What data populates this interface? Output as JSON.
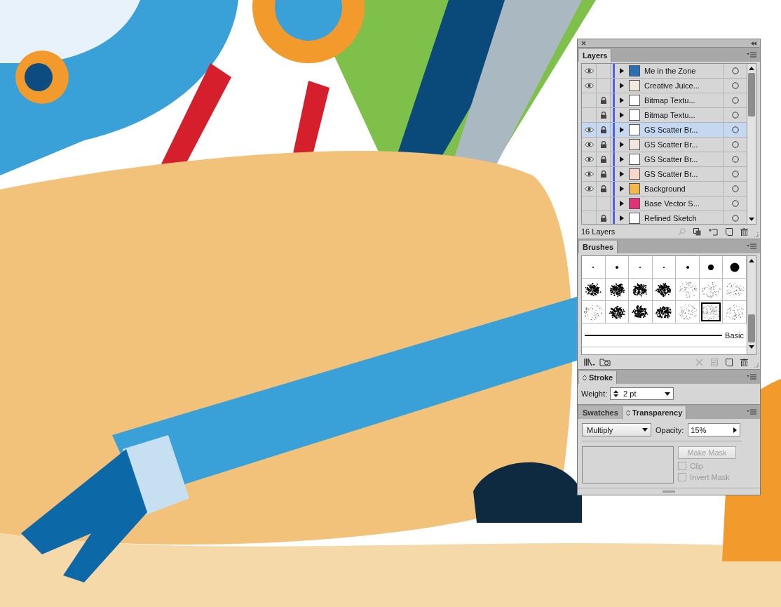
{
  "layers_panel": {
    "tab": "Layers",
    "layers": [
      {
        "name": "Me in the Zone",
        "visible": true,
        "locked": false,
        "selected": false,
        "color": "#2a6fb0"
      },
      {
        "name": "Creative Juice...",
        "visible": true,
        "locked": false,
        "selected": false,
        "color": "#f3e9dc"
      },
      {
        "name": "Bitmap Textu...",
        "visible": false,
        "locked": true,
        "selected": false,
        "color": "#ffffff"
      },
      {
        "name": "Bitmap Textu...",
        "visible": false,
        "locked": true,
        "selected": false,
        "color": "#ffffff"
      },
      {
        "name": "GS Scatter Br...",
        "visible": true,
        "locked": true,
        "selected": true,
        "color": "#ffffff"
      },
      {
        "name": "GS Scatter Br...",
        "visible": true,
        "locked": true,
        "selected": false,
        "color": "#f3e6dc"
      },
      {
        "name": "GS Scatter Br...",
        "visible": true,
        "locked": true,
        "selected": false,
        "color": "#ffffff"
      },
      {
        "name": "GS Scatter Br...",
        "visible": true,
        "locked": true,
        "selected": false,
        "color": "#f6d8c8"
      },
      {
        "name": "Background",
        "visible": true,
        "locked": true,
        "selected": false,
        "color": "#f1b94c"
      },
      {
        "name": "Base Vector S...",
        "visible": false,
        "locked": false,
        "selected": false,
        "color": "#e2337a"
      },
      {
        "name": "Refined Sketch",
        "visible": false,
        "locked": true,
        "selected": false,
        "color": "#ffffff"
      }
    ],
    "count": "16 Layers"
  },
  "brushes_panel": {
    "tab": "Brushes",
    "brushes": [
      {
        "kind": "tiny",
        "selected": false
      },
      {
        "kind": "small",
        "selected": false
      },
      {
        "kind": "tiny",
        "selected": false
      },
      {
        "kind": "tiny",
        "selected": false
      },
      {
        "kind": "small",
        "selected": false
      },
      {
        "kind": "medium",
        "selected": false
      },
      {
        "kind": "large",
        "selected": false
      },
      {
        "kind": "dense",
        "selected": false
      },
      {
        "kind": "dense",
        "selected": false
      },
      {
        "kind": "dense",
        "selected": false
      },
      {
        "kind": "dense",
        "selected": false
      },
      {
        "kind": "light",
        "selected": false
      },
      {
        "kind": "light",
        "selected": false
      },
      {
        "kind": "light",
        "selected": false
      },
      {
        "kind": "light",
        "selected": false
      },
      {
        "kind": "dense",
        "selected": false
      },
      {
        "kind": "dense",
        "selected": false
      },
      {
        "kind": "dense",
        "selected": false
      },
      {
        "kind": "light",
        "selected": false
      },
      {
        "kind": "light",
        "selected": true
      },
      {
        "kind": "light",
        "selected": false
      }
    ],
    "stroke_brush": "Basic"
  },
  "stroke_panel": {
    "tab": "Stroke",
    "weight_label": "Weight:",
    "weight": "2 pt"
  },
  "transparency_panel": {
    "tabs": [
      {
        "label": "Swatches",
        "selected": false
      },
      {
        "label": "Transparency",
        "selected": true
      }
    ],
    "blend_mode": "Multiply",
    "opacity_label": "Opacity:",
    "opacity": "15%",
    "make_mask": {
      "label": "Make Mask",
      "disabled": true
    },
    "options": [
      {
        "label": "Clip",
        "checked": false,
        "disabled": true
      },
      {
        "label": "Invert Mask",
        "checked": false,
        "disabled": true
      }
    ]
  }
}
